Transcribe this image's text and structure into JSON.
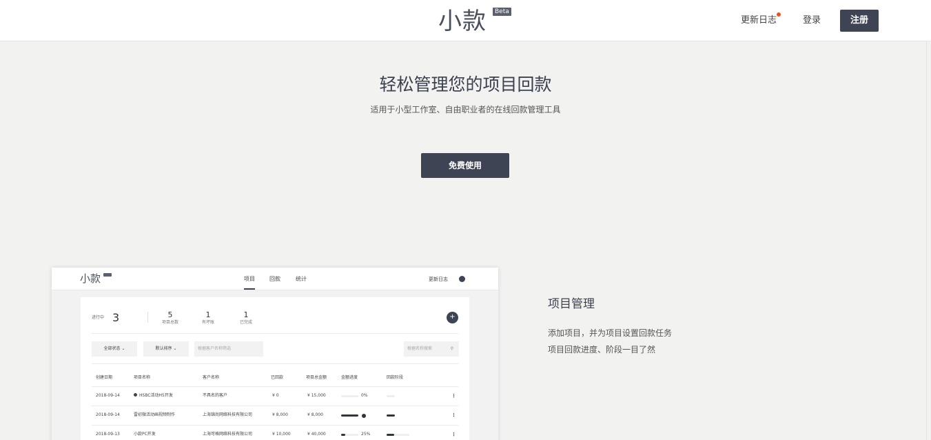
{
  "header": {
    "logo_text": "小款",
    "logo_badge": "Beta",
    "changelog_label": "更新日志",
    "login_label": "登录",
    "signup_label": "注册"
  },
  "hero": {
    "title": "轻松管理您的项目回款",
    "subtitle": "适用于小型工作室、自由职业者的在线回款管理工具",
    "cta_label": "免费使用"
  },
  "preview": {
    "logo_text": "小款",
    "tabs": [
      "项目",
      "回款",
      "统计"
    ],
    "changelog_label": "更新日志",
    "in_progress_label": "进行中",
    "in_progress_count": "3",
    "stats": [
      {
        "value": "5",
        "label": "项目总数"
      },
      {
        "value": "1",
        "label": "有坏账"
      },
      {
        "value": "1",
        "label": "已完成"
      }
    ],
    "add_symbol": "+",
    "filters": {
      "status": "全部状态 ⌄",
      "sort": "默认排序 ⌄",
      "client_placeholder": "根据客户名称筛选",
      "name_placeholder": "根据名称搜索"
    },
    "columns": [
      "创建日期",
      "项目名称",
      "客户名称",
      "已回款",
      "项目总金额",
      "金额进度",
      "回款阶段"
    ],
    "rows": [
      {
        "date": "2018-09-14",
        "name": "HSBC活动H5开发",
        "client": "不具名的客户",
        "received": "¥ 0",
        "total": "¥ 15,000",
        "progress": 0,
        "progress_label": "0%",
        "stage": 0.0
      },
      {
        "date": "2018-09-14",
        "name": "雷初微活动画视频制作",
        "client": "上海锦尚网络科技有限公司",
        "received": "¥ 8,000",
        "total": "¥ 8,000",
        "progress": 1.0,
        "progress_label": "",
        "stage": 1.0
      },
      {
        "date": "2018-09-13",
        "name": "小款PC开发",
        "client": "上海可格网络科技有限公司",
        "received": "¥ 10,000",
        "total": "¥ 40,000",
        "progress": 0.25,
        "progress_label": "25%",
        "stage": 0.33
      }
    ]
  },
  "feature": {
    "title": "项目管理",
    "line1": "添加项目，并为项目设置回款任务",
    "line2": "项目回款进度、阶段一目了然"
  }
}
